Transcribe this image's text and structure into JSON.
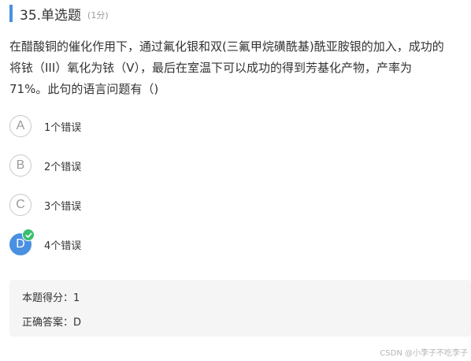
{
  "question": {
    "number_title": "35.单选题",
    "points": "(1分)",
    "text_lines": [
      "在醋酸铜的催化作用下，通过氟化银和双(三氟甲烷磺酰基)酰亚胺银的加入，成功的",
      "将铱（III）氧化为铱（V），最后在室温下可以成功的得到芳基化产物，产率为",
      "71%。此句的语言问题有（)"
    ]
  },
  "options": [
    {
      "letter": "A",
      "label": "1个错误",
      "selected": false
    },
    {
      "letter": "B",
      "label": "2个错误",
      "selected": false
    },
    {
      "letter": "C",
      "label": "3个错误",
      "selected": false
    },
    {
      "letter": "D",
      "label": "4个错误",
      "selected": true
    }
  ],
  "result": {
    "score_text": "本题得分：1",
    "answer_text": "正确答案：D"
  },
  "watermark": "CSDN @小李子不吃李子",
  "colors": {
    "accent": "#4a90e2",
    "check": "#3bbf6f",
    "panel": "#f5f5f5"
  }
}
